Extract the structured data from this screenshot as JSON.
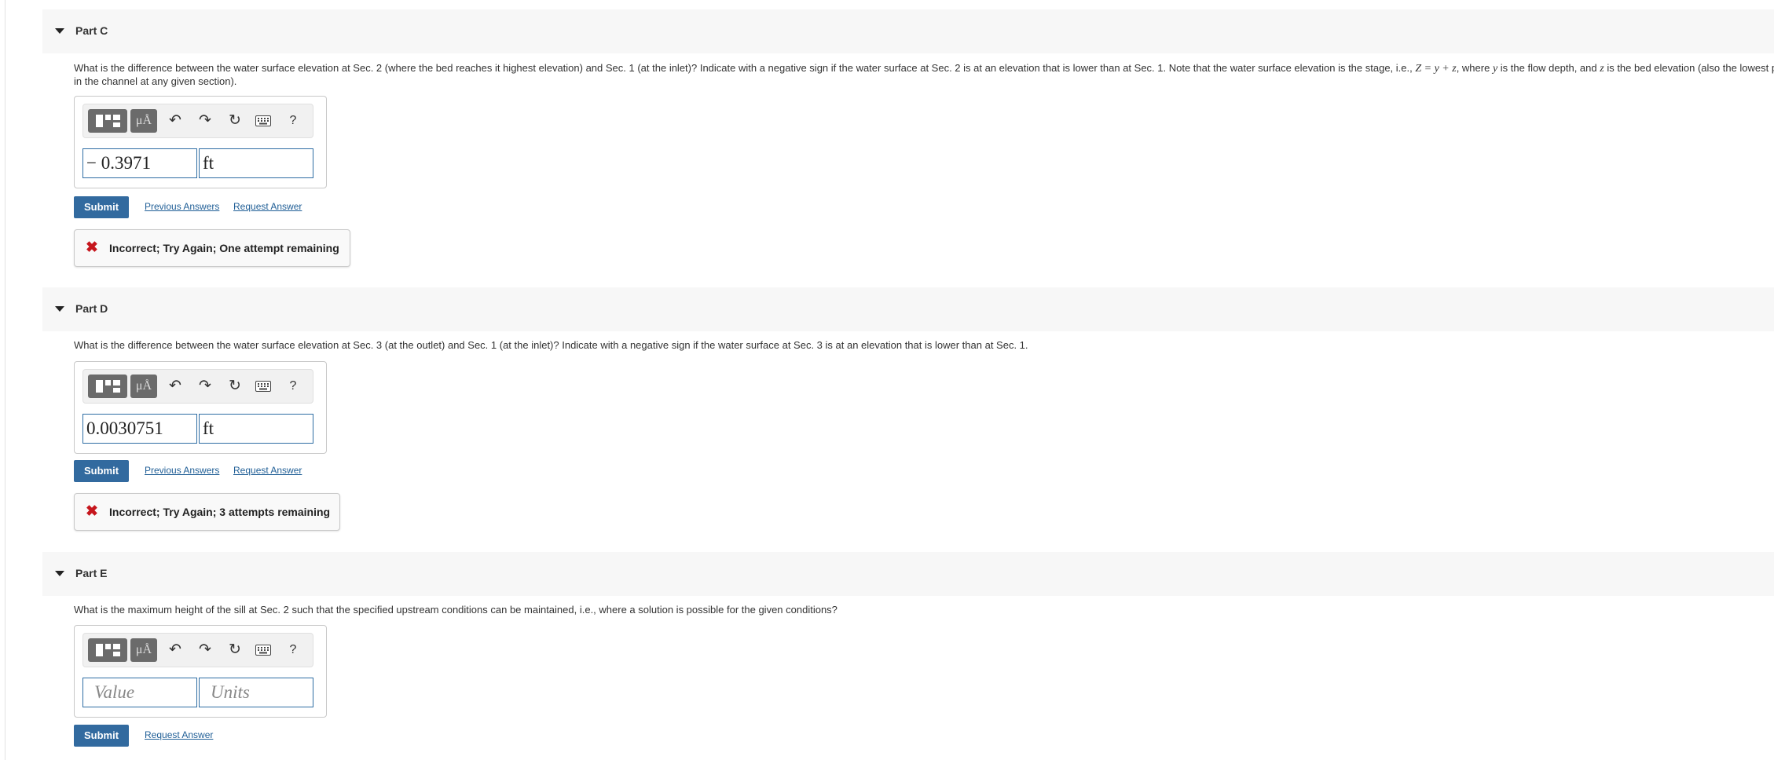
{
  "partC": {
    "title": "Part C",
    "question_1": "What is the difference between the water surface elevation at Sec. 2 (where the bed reaches it highest elevation) and Sec. 1 (at the inlet)?  Indicate with a negative sign if the water surface at Sec. 2 is at an elevation that is lower than at Sec. 1.  Note that the water surface elevation is the stage, i.e., ",
    "math_stage": "Z = y + z",
    "question_2": ", where ",
    "math_y": "y",
    "question_3": " is the flow depth, and ",
    "math_z": "z",
    "question_4": " is the bed elevation (also the lowest point in the channel at any given section).",
    "value": "− 0.3971",
    "units": "ft",
    "submit_label": "Submit",
    "previous_answers_label": "Previous Answers",
    "request_answer_label": "Request Answer",
    "feedback": "Incorrect; Try Again; One attempt remaining"
  },
  "partD": {
    "title": "Part D",
    "question": "What is the difference between the water surface elevation at Sec. 3 (at the outlet) and Sec. 1 (at the inlet)?  Indicate with a negative sign if the water surface at Sec. 3 is at an elevation that is lower than at Sec. 1.",
    "value": "0.0030751",
    "units": "ft",
    "submit_label": "Submit",
    "previous_answers_label": "Previous Answers",
    "request_answer_label": "Request Answer",
    "feedback": "Incorrect; Try Again; 3 attempts remaining"
  },
  "partE": {
    "title": "Part E",
    "question": "What is the maximum height of the sill at Sec. 2 such that the specified upstream conditions can be maintained, i.e., where a solution is possible for the given conditions?",
    "value_placeholder": "Value",
    "units_placeholder": "Units",
    "submit_label": "Submit",
    "request_answer_label": "Request Answer"
  },
  "toolbar": {
    "units_label": "μÅ",
    "undo_glyph": "↶",
    "redo_glyph": "↷",
    "reset_glyph": "↻",
    "help_label": "?"
  },
  "icons": {
    "collapse": "caret-down-icon",
    "templates": "templates-icon",
    "units": "units-icon",
    "undo": "undo-icon",
    "redo": "redo-icon",
    "reset": "reset-icon",
    "keyboard": "keyboard-icon",
    "help": "help-icon",
    "incorrect": "x-mark-icon"
  },
  "colors": {
    "submit": "#326a9f",
    "link": "#1f5e96",
    "incorrect": "#c6161d",
    "input_border": "#2e6da4",
    "header_bg": "#f7f7f7"
  }
}
